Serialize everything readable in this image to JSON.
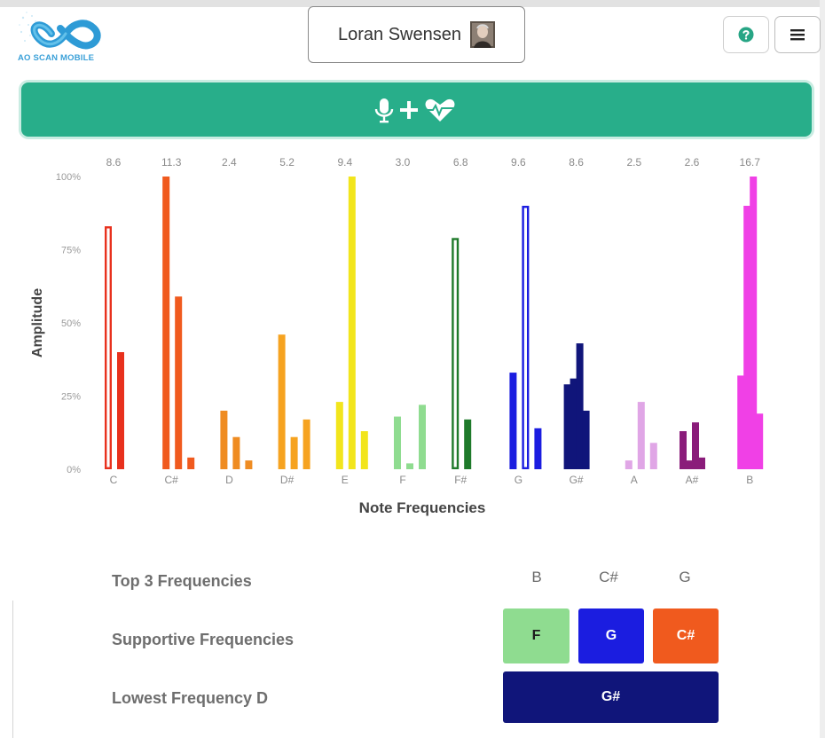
{
  "app": {
    "logo_text": "AO SCAN MOBILE"
  },
  "header": {
    "user_name": "Loran Swensen",
    "help_icon": "question-circle-icon",
    "menu_icon": "hamburger-menu-icon"
  },
  "record_button": {
    "icons": [
      "microphone-icon",
      "plus-icon",
      "heartbeat-icon"
    ],
    "color": "#28ae8a"
  },
  "chart_data": {
    "type": "bar",
    "ylabel": "Amplitude",
    "xlabel": "Note Frequencies",
    "ylim": [
      0,
      100
    ],
    "yticks": [
      "0%",
      "25%",
      "50%",
      "75%",
      "100%"
    ],
    "grid": false,
    "groups": [
      {
        "note": "C",
        "top": "8.6",
        "color": "#e8311d",
        "bars": [
          {
            "v": 83,
            "hollow": true
          },
          {
            "v": 40
          }
        ]
      },
      {
        "note": "C#",
        "top": "11.3",
        "color": "#f05a1e",
        "bars": [
          {
            "v": 100
          },
          {
            "v": 59
          },
          {
            "v": 4
          }
        ]
      },
      {
        "note": "D",
        "top": "2.4",
        "color": "#ef8c22",
        "bars": [
          {
            "v": 20
          },
          {
            "v": 11
          },
          {
            "v": 3
          }
        ]
      },
      {
        "note": "D#",
        "top": "5.2",
        "color": "#f6a320",
        "bars": [
          {
            "v": 46
          },
          {
            "v": 11
          },
          {
            "v": 17
          }
        ]
      },
      {
        "note": "E",
        "top": "9.4",
        "color": "#f2e51c",
        "bars": [
          {
            "v": 23
          },
          {
            "v": 100
          },
          {
            "v": 13
          }
        ]
      },
      {
        "note": "F",
        "top": "3.0",
        "color": "#8fdc90",
        "bars": [
          {
            "v": 18
          },
          {
            "v": 2
          },
          {
            "v": 22
          }
        ]
      },
      {
        "note": "F#",
        "top": "6.8",
        "color": "#1f7a2b",
        "bars": [
          {
            "v": 79,
            "hollow": true
          },
          {
            "v": 17
          }
        ]
      },
      {
        "note": "G",
        "top": "9.6",
        "color": "#1b1de0",
        "bars": [
          {
            "v": 33
          },
          {
            "v": 90,
            "hollow": true
          },
          {
            "v": 14
          }
        ]
      },
      {
        "note": "G#",
        "top": "8.6",
        "color": "#10157a",
        "bars": [
          {
            "v": 29
          },
          {
            "v": 31
          },
          {
            "v": 43
          },
          {
            "v": 20
          }
        ]
      },
      {
        "note": "A",
        "top": "2.5",
        "color": "#e0a6e6",
        "bars": [
          {
            "v": 3
          },
          {
            "v": 23
          },
          {
            "v": 9
          }
        ]
      },
      {
        "note": "A#",
        "top": "2.6",
        "color": "#8a1c7a",
        "bars": [
          {
            "v": 13
          },
          {
            "v": 3
          },
          {
            "v": 16
          },
          {
            "v": 4
          }
        ]
      },
      {
        "note": "B",
        "top": "16.7",
        "color": "#f040e6",
        "bars": [
          {
            "v": 32
          },
          {
            "v": 90
          },
          {
            "v": 100
          },
          {
            "v": 19
          }
        ]
      }
    ]
  },
  "summary": {
    "top3_label": "Top 3 Frequencies",
    "top3": [
      "B",
      "C#",
      "G"
    ],
    "supportive_label": "Supportive Frequencies",
    "supportive": [
      {
        "note": "F",
        "bg": "#8fdc90",
        "fg": "#1d1d1d"
      },
      {
        "note": "G",
        "bg": "#1b1de0",
        "fg": "#ffffff"
      },
      {
        "note": "C#",
        "bg": "#f05a1e",
        "fg": "#ffffff"
      }
    ],
    "lowest_label": "Lowest Frequency D",
    "lowest_tile": {
      "note": "G#",
      "bg": "#10157a",
      "fg": "#ffffff"
    }
  }
}
